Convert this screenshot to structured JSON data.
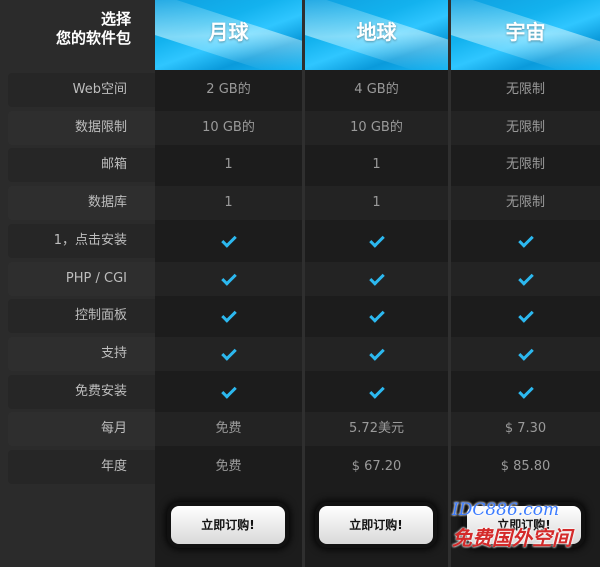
{
  "header": {
    "line1": "选择",
    "line2": "您的软件包",
    "plans": [
      "月球",
      "地球",
      "宇宙"
    ]
  },
  "rows": [
    {
      "label": "Web空间",
      "values": [
        "2 GB的",
        "4 GB的",
        "无限制"
      ]
    },
    {
      "label": "数据限制",
      "values": [
        "10 GB的",
        "10 GB的",
        "无限制"
      ]
    },
    {
      "label": "邮箱",
      "values": [
        "1",
        "1",
        "无限制"
      ]
    },
    {
      "label": "数据库",
      "values": [
        "1",
        "1",
        "无限制"
      ]
    },
    {
      "label": "1，点击安装",
      "values": [
        "check",
        "check",
        "check"
      ]
    },
    {
      "label": "PHP / CGI",
      "values": [
        "check",
        "check",
        "check"
      ]
    },
    {
      "label": "控制面板",
      "values": [
        "check",
        "check",
        "check"
      ]
    },
    {
      "label": "支持",
      "values": [
        "check",
        "check",
        "check"
      ]
    },
    {
      "label": "免费安装",
      "values": [
        "check",
        "check",
        "check"
      ]
    },
    {
      "label": "每月",
      "values": [
        "免费",
        "5.72美元",
        "$ 7.30"
      ]
    },
    {
      "label": "年度",
      "values": [
        "免费",
        "$ 67.20",
        "$ 85.80"
      ]
    }
  ],
  "buttons": [
    "立即订购!",
    "立即订购!",
    "立即订购!"
  ],
  "watermark": {
    "line1": "IDC886.com",
    "line2": "免费国外空间"
  },
  "colors": {
    "accent": "#2cb8ef",
    "header_blue": "#13b2ee"
  }
}
